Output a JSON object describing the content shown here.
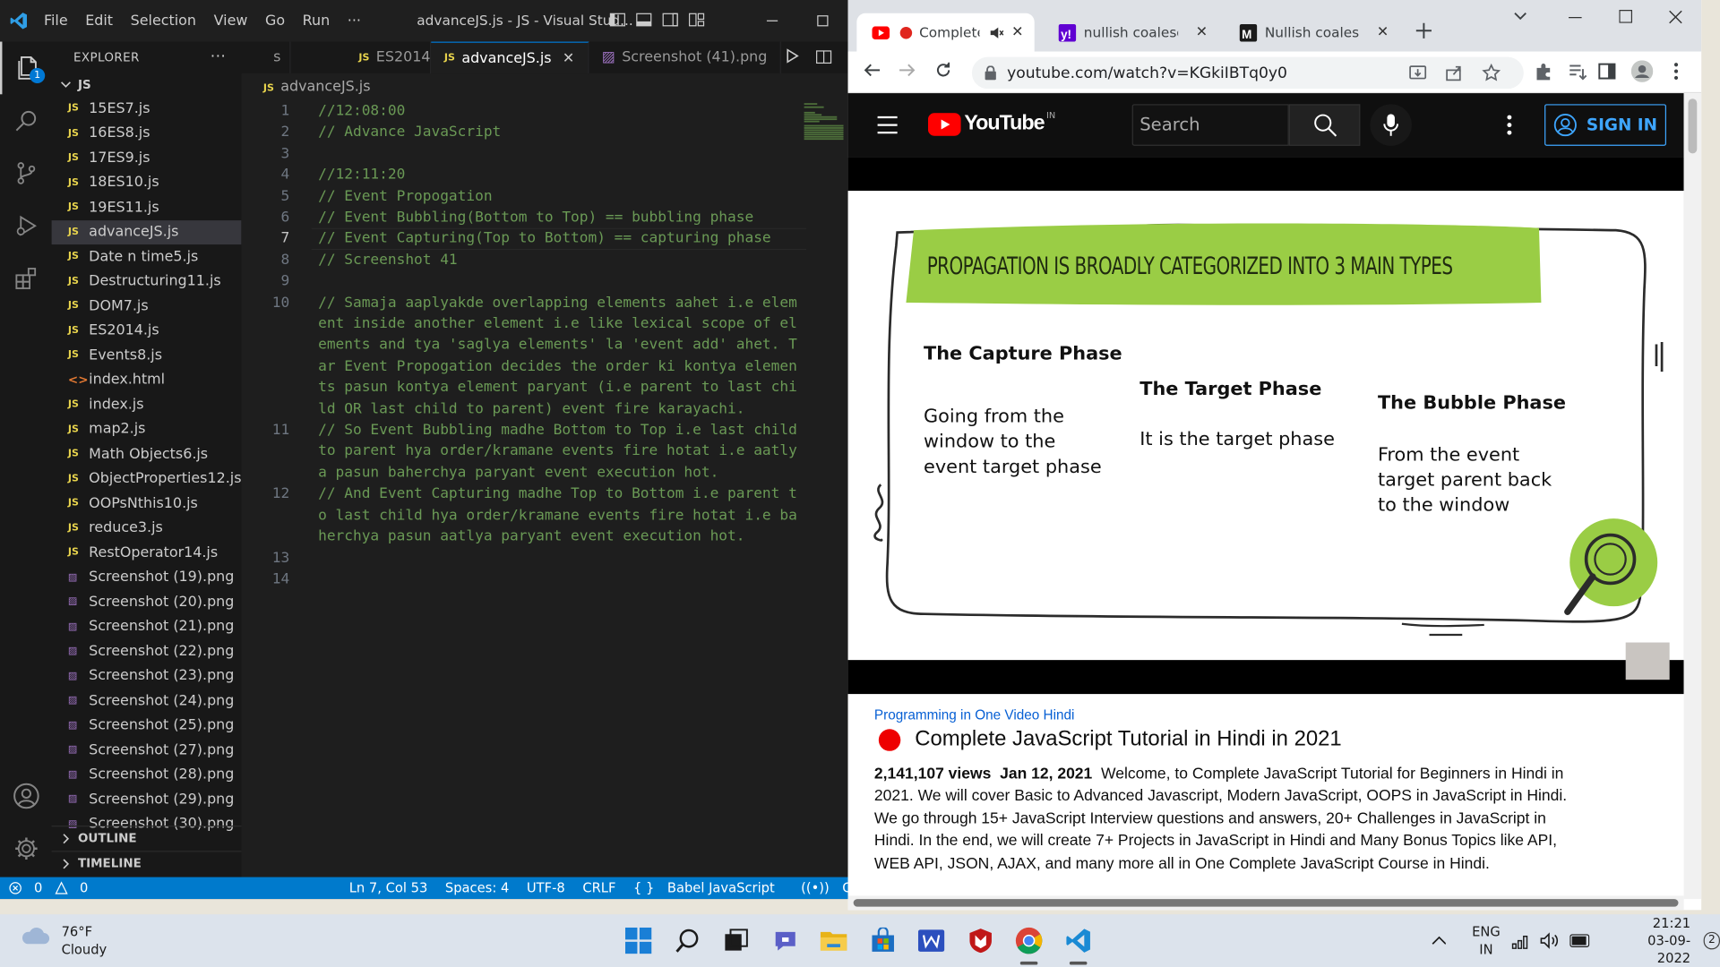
{
  "vscode": {
    "menu": [
      "File",
      "Edit",
      "Selection",
      "View",
      "Go",
      "Run",
      "···"
    ],
    "window_title": "advanceJS.js - JS - Visual Stud...",
    "explorer_title": "EXPLORER",
    "folder": "JS",
    "files": [
      {
        "name": "15ES7.js",
        "type": "js"
      },
      {
        "name": "16ES8.js",
        "type": "js"
      },
      {
        "name": "17ES9.js",
        "type": "js"
      },
      {
        "name": "18ES10.js",
        "type": "js"
      },
      {
        "name": "19ES11.js",
        "type": "js"
      },
      {
        "name": "advanceJS.js",
        "type": "js",
        "selected": true
      },
      {
        "name": "Date n time5.js",
        "type": "js"
      },
      {
        "name": "Destructuring11.js",
        "type": "js"
      },
      {
        "name": "DOM7.js",
        "type": "js"
      },
      {
        "name": "ES2014.js",
        "type": "js"
      },
      {
        "name": "Events8.js",
        "type": "js"
      },
      {
        "name": "index.html",
        "type": "html"
      },
      {
        "name": "index.js",
        "type": "js"
      },
      {
        "name": "map2.js",
        "type": "js"
      },
      {
        "name": "Math Objects6.js",
        "type": "js"
      },
      {
        "name": "ObjectProperties12.js",
        "type": "js"
      },
      {
        "name": "OOPsNthis10.js",
        "type": "js"
      },
      {
        "name": "reduce3.js",
        "type": "js"
      },
      {
        "name": "RestOperator14.js",
        "type": "js"
      },
      {
        "name": "Screenshot (19).png",
        "type": "png"
      },
      {
        "name": "Screenshot (20).png",
        "type": "png"
      },
      {
        "name": "Screenshot (21).png",
        "type": "png"
      },
      {
        "name": "Screenshot (22).png",
        "type": "png"
      },
      {
        "name": "Screenshot (23).png",
        "type": "png"
      },
      {
        "name": "Screenshot (24).png",
        "type": "png"
      },
      {
        "name": "Screenshot (25).png",
        "type": "png"
      },
      {
        "name": "Screenshot (27).png",
        "type": "png"
      },
      {
        "name": "Screenshot (28).png",
        "type": "png"
      },
      {
        "name": "Screenshot (29).png",
        "type": "png"
      },
      {
        "name": "Screenshot (30).png",
        "type": "png"
      }
    ],
    "outline": "OUTLINE",
    "timeline": "TIMELINE",
    "tabs": [
      {
        "label": "s",
        "kind": "partial"
      },
      {
        "label": "ES2014.js",
        "kind": "js"
      },
      {
        "label": "advanceJS.js",
        "kind": "js",
        "active": true
      },
      {
        "label": "Screenshot (41).png",
        "kind": "png"
      }
    ],
    "breadcrumb": "advanceJS.js",
    "current_line": 7,
    "code_lines": [
      {
        "n": 1,
        "text": "//12:08:00"
      },
      {
        "n": 2,
        "text": "// Advance JavaScript"
      },
      {
        "n": 3,
        "text": ""
      },
      {
        "n": 4,
        "text": "//12:11:20"
      },
      {
        "n": 5,
        "text": "// Event Propogation"
      },
      {
        "n": 6,
        "text": "// Event Bubbling(Bottom to Top) == bubbling phase"
      },
      {
        "n": 7,
        "text": "// Event Capturing(Top to Bottom) == capturing phase"
      },
      {
        "n": 8,
        "text": "// Screenshot 41"
      },
      {
        "n": 9,
        "text": ""
      },
      {
        "n": 10,
        "text": "// Samaja aaplyakde overlapping elements aahet i.e element inside another element i.e like lexical scope of elements and tya 'saglya elements' la 'event add' ahet. Tar Event Propogation decides the order ki kontya elements pasun kontya element paryant (i.e parent to last child OR last child to parent) event fire karayachi."
      },
      {
        "n": 11,
        "text": "// So Event Bubbling madhe Bottom to Top i.e last child to parent hya order/kramane events fire hotat i.e aatlya pasun baherchya paryant event execution hot."
      },
      {
        "n": 12,
        "text": "// And Event Capturing madhe Top to Bottom i.e parent to last child hya order/kramane events fire hotat i.e baherchya pasun aatlya paryant event execution hot."
      },
      {
        "n": 13,
        "text": ""
      },
      {
        "n": 14,
        "text": ""
      }
    ],
    "status": {
      "errors": "0",
      "warnings": "0",
      "position": "Ln 7, Col 53",
      "spaces": "Spaces: 4",
      "encoding": "UTF-8",
      "eol": "CRLF",
      "language": "Babel JavaScript",
      "golive": "Go Live"
    }
  },
  "chrome": {
    "tabs": [
      {
        "title": "Complete",
        "favicon": "youtube",
        "active": true,
        "muted": true
      },
      {
        "title": "nullish coalescing",
        "favicon": "yahoo"
      },
      {
        "title": "Nullish coalescing",
        "favicon": "mdn"
      }
    ],
    "url": "youtube.com/watch?v=KGkiIBTq0y0",
    "youtube": {
      "region": "IN",
      "wordmark": "YouTube",
      "search_placeholder": "Search",
      "sign_in": "SIGN IN",
      "slide": {
        "banner": "PROPAGATION IS BROADLY CATEGORIZED INTO 3 MAIN TYPES",
        "phases": [
          {
            "title": "The Capture Phase",
            "body": "Going from the window to the event target phase"
          },
          {
            "title": "The Target Phase",
            "body": "It is the target phase"
          },
          {
            "title": "The Bubble Phase",
            "body": "From the event target parent back to the window"
          }
        ]
      },
      "channel": "Programming in One Video Hindi",
      "title": "Complete JavaScript Tutorial in Hindi in 2021",
      "views": "2,141,107 views",
      "date": "Jan 12, 2021",
      "description": "Welcome, to Complete JavaScript Tutorial for Beginners in Hindi in 2021. We will cover Basic to Advanced Javascript, Modern JavaScript, OOPS in JavaScript in Hindi. We go through 15+ JavaScript Interview questions and answers, 20+ Challenges in JavaScript in Hindi. In the end, we will create 7+ Projects in JavaScript in Hindi and Many Bonus Topics like API, WEB API, JSON, AJAX, and many more all in One Complete JavaScript Course in Hindi."
    }
  },
  "taskbar": {
    "temperature": "76°F",
    "condition": "Cloudy",
    "lang1": "ENG",
    "lang2": "IN",
    "time": "21:21",
    "date": "03-09-2022",
    "notifications": "2",
    "apps": [
      "start-icon",
      "search-icon",
      "task-view-icon",
      "teams-chat-icon",
      "file-explorer-icon",
      "microsoft-store-icon",
      "word-icon",
      "mcafee-icon",
      "chrome-icon",
      "vscode-icon"
    ]
  },
  "colors": {
    "vscode_blue": "#007acc",
    "comment_green": "#6a9955",
    "youtube_red": "#ff0000",
    "slide_green": "#9acd45",
    "link_blue": "#065fd4"
  }
}
